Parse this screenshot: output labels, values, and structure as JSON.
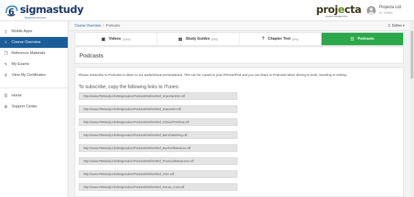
{
  "brand": {
    "logo_number": "6",
    "logo_name": "sigmastudy",
    "logo_tagline": "Targeting success",
    "partner_name_1": "proj",
    "partner_name_2": "e",
    "partner_name_3": "cta",
    "partner_tagline": "project management"
  },
  "user": {
    "name": "Projecta Ltd",
    "id": "ID: 709665"
  },
  "sidebar": {
    "items": [
      {
        "label": "Mobile Apps",
        "icon": "mobile-icon"
      },
      {
        "label": "Course Overview",
        "icon": "home-icon"
      },
      {
        "label": "Reference Materials",
        "icon": "document-icon"
      },
      {
        "label": "My Exams",
        "icon": "edit-icon"
      },
      {
        "label": "View My Certificates",
        "icon": "search-icon"
      }
    ],
    "bottom_items": [
      {
        "label": "Home",
        "icon": "list-icon"
      },
      {
        "label": "Support Center",
        "icon": "support-icon"
      }
    ]
  },
  "breadcrumb": {
    "parent": "Course Overview",
    "separator": "/",
    "current": "Podcasts"
  },
  "define_menu": "2. Define",
  "tabs": [
    {
      "label": "Videos",
      "pct": "(14%)",
      "icon": "video-icon"
    },
    {
      "label": "Study Guides",
      "pct": "(0%)",
      "icon": "book-icon"
    },
    {
      "label": "Chapter Test",
      "pct": "(0%)",
      "icon": "question-icon"
    },
    {
      "label": "Podcasts",
      "pct": "",
      "icon": "podcast-icon"
    }
  ],
  "page_title": "Podcasts",
  "intro_text": "Please subscribe to Podcasts to listen to our audio/visual presentations. This can be copied to your iPhone/iPod and you can listen to Podcasts when driving to work, traveling or resting.",
  "subscribe_heading": "To subscribe, copy the following links to iTunes:",
  "links": [
    "http://www.PMstudy.info/6sigmadoc/Podcast/Define/Def_ImportantSH.rdf",
    "http://www.PMstudy.info/6sigmadoc/Podcast/Define/Def_ImpactSH.rdf",
    "http://www.PMstudy.info/6sigmadoc/Podcast/Define/Def_CriticalTOXReq.rdf",
    "http://www.PMstudy.info/6sigmadoc/Podcast/Define/Def_BenchMarking.rdf",
    "http://www.PMstudy.info/6sigmadoc/Podcast/Define/Def_BusPerfMeasure.rdf",
    "http://www.PMstudy.info/6sigmadoc/Podcast/Define/Def_FinancialMeasures.rdf",
    "http://www.PMstudy.info/6sigmadoc/Podcast/Define/Def_VOC.rdf",
    "http://www.PMstudy.info/6sigmadoc/Podcast/Define/Def_Kenos_Cust.rdf"
  ],
  "colors": {
    "primary": "#1c5d99",
    "active_tab": "#2aa84a"
  }
}
